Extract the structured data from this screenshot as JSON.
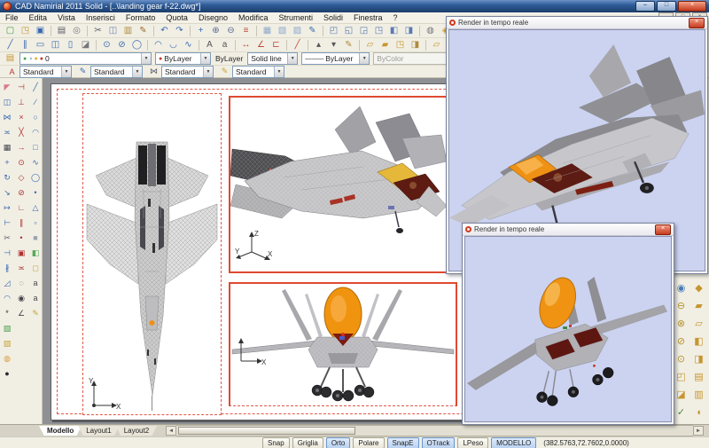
{
  "titlebar": {
    "title": "CAD Namirial 2011 Solid - [..\\landing gear f-22.dwg*]",
    "minimize": "–",
    "maximize": "□",
    "close": "×"
  },
  "menu": {
    "items": [
      "File",
      "Edita",
      "Vista",
      "Inserisci",
      "Formato",
      "Quota",
      "Disegno",
      "Modifica",
      "Strumenti",
      "Solidi",
      "Finestra",
      "?"
    ],
    "mdi_controls": [
      "–",
      "□",
      "×"
    ]
  },
  "toolbar_row1": [
    {
      "n": "new-file",
      "g": "▢",
      "c": "#3f9b46"
    },
    {
      "n": "open-file",
      "g": "◳",
      "c": "#c79530"
    },
    {
      "n": "save-file",
      "g": "▣",
      "c": "#3b68ae"
    },
    {
      "sep": true
    },
    {
      "n": "print",
      "g": "▤",
      "c": "#5a5a66"
    },
    {
      "n": "print-preview",
      "g": "◎",
      "c": "#76767e"
    },
    {
      "sep": true
    },
    {
      "n": "cut",
      "g": "✂",
      "c": "#5a5a66"
    },
    {
      "n": "copy-clip",
      "g": "◫",
      "c": "#6d83b4"
    },
    {
      "n": "paste",
      "g": "▥",
      "c": "#b08a40"
    },
    {
      "n": "match-properties",
      "g": "✎",
      "c": "#9a6a2e"
    },
    {
      "sep": true
    },
    {
      "n": "undo",
      "g": "↶",
      "c": "#3b68ae"
    },
    {
      "n": "redo",
      "g": "↷",
      "c": "#3b68ae"
    },
    {
      "sep": true
    },
    {
      "n": "pan",
      "g": "+",
      "c": "#3b68ae"
    },
    {
      "n": "zoom-realtime",
      "g": "⊕",
      "c": "#566a90"
    },
    {
      "n": "zoom-previous",
      "g": "⊖",
      "c": "#566a90"
    },
    {
      "n": "layer-manager",
      "g": "≡",
      "c": "#c0483c"
    },
    {
      "sep": true
    },
    {
      "n": "shade-2d",
      "g": "▦",
      "c": "#8fa8cc"
    },
    {
      "n": "shade-hidden",
      "g": "▧",
      "c": "#8fa8cc"
    },
    {
      "n": "shade-render",
      "g": "▨",
      "c": "#8fa8cc"
    },
    {
      "n": "draw-order",
      "g": "✎",
      "c": "#3b68ae"
    },
    {
      "sep": true
    },
    {
      "n": "view-top",
      "g": "◰",
      "c": "#5a7ab2"
    },
    {
      "n": "view-front",
      "g": "◱",
      "c": "#5a7ab2"
    },
    {
      "n": "view-right",
      "g": "◲",
      "c": "#5a7ab2"
    },
    {
      "n": "view-iso-sw",
      "g": "◳",
      "c": "#5a7ab2"
    },
    {
      "n": "view-iso-se",
      "g": "◧",
      "c": "#5a7ab2"
    },
    {
      "n": "view-iso-ne",
      "g": "◨",
      "c": "#5a7ab2"
    },
    {
      "sep": true
    },
    {
      "n": "named-views",
      "g": "◍",
      "c": "#76767e"
    },
    {
      "n": "materials",
      "g": "◈",
      "c": "#c79530"
    }
  ],
  "toolbar_row2": [
    {
      "n": "line",
      "g": "╱",
      "c": "#3b68ae"
    },
    {
      "n": "construction-line",
      "g": "∥",
      "c": "#3b68ae"
    },
    {
      "n": "rectangle",
      "g": "▭",
      "c": "#3b68ae"
    },
    {
      "n": "multiline",
      "g": "◫",
      "c": "#3b68ae"
    },
    {
      "n": "polygon",
      "g": "▯",
      "c": "#3b68ae"
    },
    {
      "n": "hatch",
      "g": "◪",
      "c": "#76767e"
    },
    {
      "sep": true
    },
    {
      "n": "circle-center",
      "g": "⊙",
      "c": "#3b68ae"
    },
    {
      "n": "circle-2p",
      "g": "⊘",
      "c": "#3b68ae"
    },
    {
      "n": "circle-tan",
      "g": "◯",
      "c": "#3b68ae"
    },
    {
      "sep": true
    },
    {
      "n": "arc",
      "g": "◠",
      "c": "#3b68ae"
    },
    {
      "n": "arc-3p",
      "g": "◡",
      "c": "#3b68ae"
    },
    {
      "n": "spline",
      "g": "∿",
      "c": "#3b68ae"
    },
    {
      "sep": true
    },
    {
      "n": "text-single",
      "g": "A",
      "c": "#555555"
    },
    {
      "n": "text-mtext",
      "g": "a",
      "c": "#555555"
    },
    {
      "sep": true
    },
    {
      "n": "dim-linear",
      "g": "↔",
      "c": "#c0483c"
    },
    {
      "n": "dim-angular",
      "g": "∠",
      "c": "#c0483c"
    },
    {
      "n": "dim-baseline",
      "g": "⊏",
      "c": "#c0483c"
    },
    {
      "sep": true
    },
    {
      "n": "leader",
      "g": "╱",
      "c": "#c0483c"
    },
    {
      "sep": true
    },
    {
      "n": "point-single",
      "g": "▴",
      "c": "#555555"
    },
    {
      "n": "point-multiple",
      "g": "▾",
      "c": "#555555"
    },
    {
      "n": "point-style",
      "g": "✎",
      "c": "#b08a40"
    },
    {
      "sep": true
    },
    {
      "n": "block-create",
      "g": "▱",
      "c": "#c79530"
    },
    {
      "n": "block-insert",
      "g": "▰",
      "c": "#c79530"
    },
    {
      "n": "block-attributes",
      "g": "◳",
      "c": "#c79530"
    },
    {
      "n": "image-attach",
      "g": "◨",
      "c": "#b08a40"
    },
    {
      "sep": true
    },
    {
      "n": "group-create",
      "g": "▱",
      "c": "#c79530"
    },
    {
      "n": "group-explode",
      "g": "▲",
      "c": "#c79530"
    },
    {
      "n": "group-preview",
      "g": "◉",
      "c": "#c79530"
    },
    {
      "n": "group-open",
      "g": "◖",
      "c": "#c79530"
    },
    {
      "sep": true
    },
    {
      "n": "solid-gold",
      "g": "◆",
      "c": "#c79530"
    },
    {
      "n": "tool-disabled",
      "g": "▫",
      "c": "#b8b8b8",
      "d": true
    }
  ],
  "left_toolbox": {
    "col1": [
      {
        "n": "erase",
        "g": "◤",
        "c": "#d87a8a"
      },
      {
        "n": "copy",
        "g": "◫",
        "c": "#3b68ae"
      },
      {
        "n": "mirror",
        "g": "⋈",
        "c": "#3b68ae"
      },
      {
        "n": "offset",
        "g": "≍",
        "c": "#3b68ae"
      },
      {
        "n": "array",
        "g": "▦",
        "c": "#44444c"
      },
      {
        "n": "move",
        "g": "+",
        "c": "#3b68ae"
      },
      {
        "n": "rotate",
        "g": "↻",
        "c": "#3b68ae"
      },
      {
        "n": "scale",
        "g": "↘",
        "c": "#3b68ae"
      },
      {
        "n": "stretch",
        "g": "↦",
        "c": "#3b68ae"
      },
      {
        "n": "lengthen",
        "g": "⊢",
        "c": "#3b68ae"
      },
      {
        "n": "trim",
        "g": "✂",
        "c": "#5a5a66"
      },
      {
        "n": "extend",
        "g": "⊣",
        "c": "#3b68ae"
      },
      {
        "n": "break",
        "g": "∦",
        "c": "#3b68ae"
      },
      {
        "n": "chamfer",
        "g": "◿",
        "c": "#3b68ae"
      },
      {
        "n": "fillet",
        "g": "◠",
        "c": "#3b68ae"
      },
      {
        "n": "explode",
        "g": "*",
        "c": "#33333a"
      },
      {
        "n": "region",
        "g": "▧",
        "c": "#4a9a4a"
      },
      {
        "n": "boundary",
        "g": "▨",
        "c": "#c8a43c"
      },
      {
        "n": "donut",
        "g": "◍",
        "c": "#d89a3c"
      },
      {
        "n": "bomb-explode",
        "g": "●",
        "c": "#2a2a2a"
      }
    ],
    "col2": [
      {
        "n": "osnap-endpoint",
        "g": "⊣",
        "c": "#b03030"
      },
      {
        "n": "osnap-midpoint",
        "g": "⊥",
        "c": "#b03030"
      },
      {
        "n": "osnap-intersection",
        "g": "×",
        "c": "#b03030"
      },
      {
        "n": "osnap-apparent",
        "g": "╳",
        "c": "#b03030"
      },
      {
        "n": "osnap-extension",
        "g": "→",
        "c": "#b03030"
      },
      {
        "n": "osnap-center",
        "g": "⊙",
        "c": "#b03030"
      },
      {
        "n": "osnap-quadrant",
        "g": "◇",
        "c": "#b03030"
      },
      {
        "n": "osnap-tangent",
        "g": "⊘",
        "c": "#b03030"
      },
      {
        "n": "osnap-perpendicular",
        "g": "∟",
        "c": "#b03030"
      },
      {
        "n": "osnap-parallel",
        "g": "∥",
        "c": "#b03030"
      },
      {
        "n": "osnap-node",
        "g": "•",
        "c": "#b03030"
      },
      {
        "n": "osnap-insert",
        "g": "▣",
        "c": "#b03030"
      },
      {
        "n": "osnap-nearest",
        "g": "≍",
        "c": "#b03030"
      },
      {
        "n": "osnap-none",
        "g": "◌",
        "c": "#44444c"
      },
      {
        "n": "osnap-settings",
        "g": "◉",
        "c": "#44444c"
      },
      {
        "n": "polar-tracking",
        "g": "∠",
        "c": "#44444c"
      }
    ],
    "col3": [
      {
        "n": "draw-line",
        "g": "╱",
        "c": "#3b68ae"
      },
      {
        "n": "draw-ray",
        "g": "∕",
        "c": "#3b68ae"
      },
      {
        "n": "draw-circle",
        "g": "○",
        "c": "#3b68ae"
      },
      {
        "n": "draw-arc",
        "g": "◠",
        "c": "#3b68ae"
      },
      {
        "n": "draw-rect",
        "g": "□",
        "c": "#3b68ae"
      },
      {
        "n": "draw-pline",
        "g": "∿",
        "c": "#3b68ae"
      },
      {
        "n": "draw-ellipse",
        "g": "◯",
        "c": "#3b68ae"
      },
      {
        "n": "draw-point",
        "g": "•",
        "c": "#3b68ae"
      },
      {
        "n": "draw-polygon",
        "g": "△",
        "c": "#3b68ae"
      },
      {
        "n": "draw-region",
        "g": "▫",
        "c": "#3b68ae"
      },
      {
        "n": "shade-box",
        "g": "■",
        "c": "#9aa4b0"
      },
      {
        "n": "tool-green",
        "g": "◧",
        "c": "#58a858"
      },
      {
        "n": "tool-balloon",
        "g": "◻",
        "c": "#c8a43c"
      },
      {
        "n": "named-a1",
        "g": "a",
        "c": "#444444"
      },
      {
        "n": "named-a2",
        "g": "a",
        "c": "#444444"
      },
      {
        "n": "sketch-pen",
        "g": "✎",
        "c": "#c8a43c"
      }
    ]
  },
  "right_toolbox": {
    "col1": [
      {
        "n": "solid-union",
        "g": "⊕",
        "c": "#b8922e"
      },
      {
        "n": "render-globe",
        "g": "◉",
        "c": "#4a7ab5"
      },
      {
        "n": "solid-subtract",
        "g": "⊖",
        "c": "#b8922e"
      },
      {
        "n": "solid-intersect",
        "g": "⊗",
        "c": "#b8922e"
      },
      {
        "n": "solid-interfere",
        "g": "⊘",
        "c": "#b8922e"
      },
      {
        "n": "solid-extract-edges",
        "g": "⊙",
        "c": "#b8922e"
      },
      {
        "n": "solid-imprint",
        "g": "◰",
        "c": "#c79530"
      },
      {
        "n": "solid-thicken",
        "g": "◪",
        "c": "#c79530"
      },
      {
        "n": "solid-check",
        "g": "✓",
        "c": "#4a8a3a"
      }
    ],
    "col2": [
      {
        "n": "solid-box",
        "g": "◇",
        "c": "#c79530"
      },
      {
        "n": "solid-wedge",
        "g": "◆",
        "c": "#c79530"
      },
      {
        "n": "solid-cylinder",
        "g": "▰",
        "c": "#c79530"
      },
      {
        "n": "solid-cone",
        "g": "▱",
        "c": "#c79530"
      },
      {
        "n": "solid-sphere",
        "g": "◧",
        "c": "#c79530"
      },
      {
        "n": "solid-torus",
        "g": "◨",
        "c": "#c79530"
      },
      {
        "n": "solid-polysolid",
        "g": "▤",
        "c": "#c79530"
      },
      {
        "n": "solid-loft",
        "g": "▥",
        "c": "#c79530"
      },
      {
        "n": "solid-sweep",
        "g": "◖",
        "c": "#c79530"
      }
    ]
  },
  "properties_bar": {
    "layer": {
      "value": "0",
      "badges": [
        {
          "g": "●",
          "c": "#49a64f"
        },
        {
          "g": "◑",
          "c": "#7aa8c8"
        },
        {
          "g": "●",
          "c": "#d8b23c"
        },
        {
          "g": "●",
          "c": "#c0392b"
        }
      ]
    },
    "color": {
      "value": "ByLayer",
      "swatch": "#c0392b"
    },
    "linetype_label": "ByLayer",
    "linetype": {
      "value": "Solid line"
    },
    "lineweight": {
      "glyph": "———",
      "value": "ByLayer"
    },
    "plot_style": {
      "value": "ByColor"
    }
  },
  "styles_bar": {
    "items": [
      {
        "n": "text-style",
        "icon": "A",
        "ic": "#b03a3a",
        "value": "Standard"
      },
      {
        "n": "dim-style",
        "icon": "✎",
        "ic": "#3b68ae",
        "value": "Standard"
      },
      {
        "n": "table-style",
        "icon": "⋈",
        "ic": "#5a5a66",
        "value": "Standard"
      },
      {
        "n": "mleader-style",
        "icon": "✎",
        "ic": "#c8a43c",
        "value": "Standard"
      }
    ]
  },
  "render_windows": [
    {
      "title": "Render in tempo reale",
      "close": "×"
    },
    {
      "title": "Render in tempo reale",
      "close": "×"
    }
  ],
  "ucs": {
    "x": "X",
    "y": "Y",
    "z": "Z"
  },
  "tabs": {
    "items": [
      "Modello",
      "Layout1",
      "Layout2"
    ],
    "active": "Modello"
  },
  "scrollbar": {
    "left_arrow": "◄",
    "right_arrow": "►"
  },
  "status_bar": {
    "toggles": [
      {
        "label": "Snap",
        "active": false
      },
      {
        "label": "Griglia",
        "active": false
      },
      {
        "label": "Orto",
        "active": true
      },
      {
        "label": "Polare",
        "active": false
      },
      {
        "label": "SnapE",
        "active": true
      },
      {
        "label": "OTrack",
        "active": true
      },
      {
        "label": "LPeso",
        "active": false
      },
      {
        "label": "MODELLO",
        "active": true
      }
    ],
    "coordinates": "(382.5763,72.7602,0.0000)"
  },
  "colors": {
    "render_bg": "#ccd3f1",
    "viewport_border": "#df4a33",
    "canopy_orange": "#f0930f",
    "cockpit_red": "#5e1b12",
    "titlebar_blue": "#2f5b97"
  }
}
